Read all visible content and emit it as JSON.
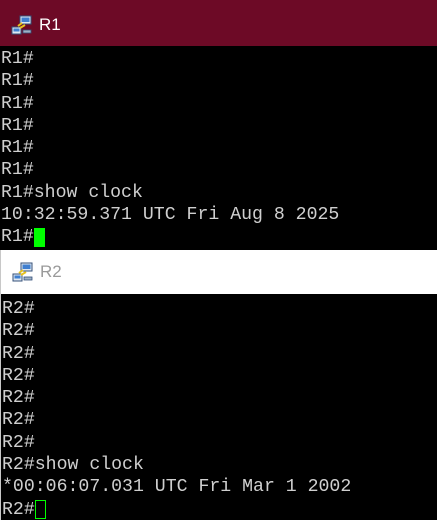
{
  "windows": [
    {
      "title": "R1",
      "icon": "network-devices-icon",
      "state": "active",
      "accent": "#6d0a26",
      "lines": [
        "R1#",
        "R1#",
        "R1#",
        "R1#",
        "R1#",
        "R1#",
        "R1#show clock",
        "10:32:59.371 UTC Fri Aug 8 2025"
      ],
      "prompt": "R1#",
      "cursor": "filled"
    },
    {
      "title": "R2",
      "icon": "network-devices-icon",
      "state": "inactive",
      "lines": [
        "R2#",
        "R2#",
        "R2#",
        "R2#",
        "R2#",
        "R2#",
        "R2#",
        "R2#show clock",
        "*00:06:07.031 UTC Fri Mar 1 2002"
      ],
      "prompt": "R2#",
      "cursor": "hollow"
    }
  ],
  "colors": {
    "terminal_bg": "#000000",
    "terminal_text": "#cfcfcf",
    "cursor": "#00ff00"
  }
}
